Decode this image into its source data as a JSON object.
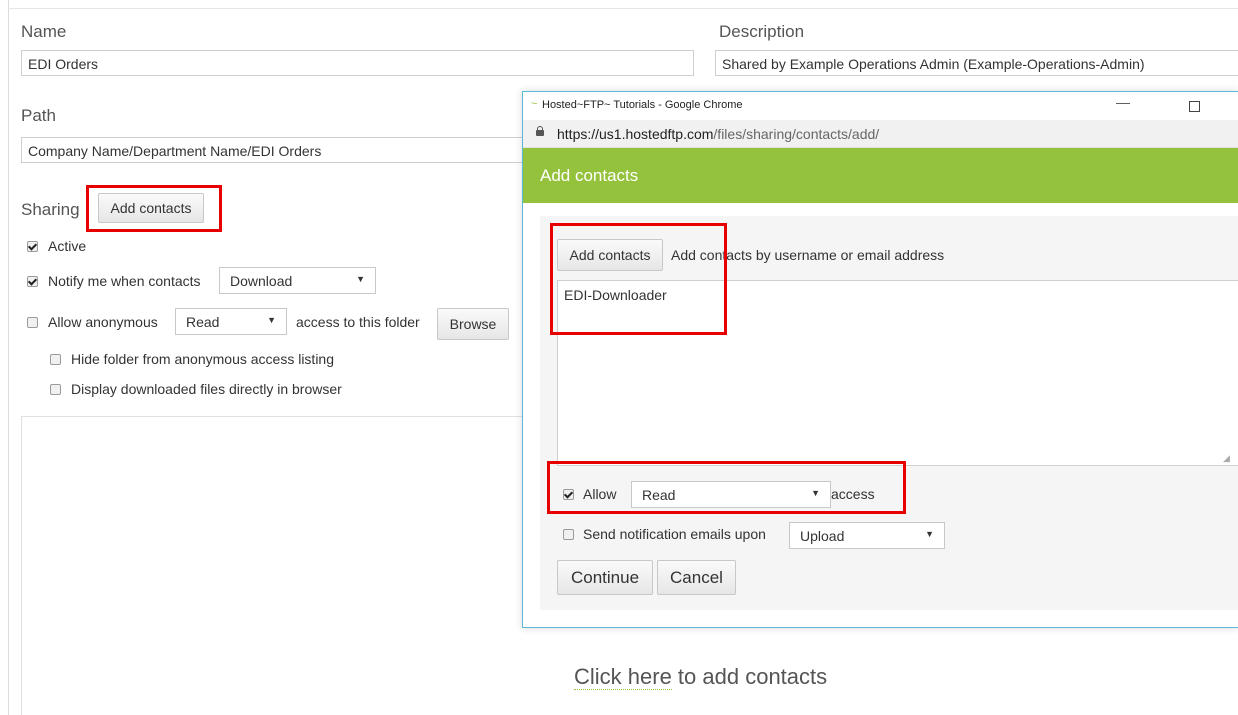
{
  "form": {
    "name_label": "Name",
    "name_value": "EDI Orders",
    "description_label": "Description",
    "description_value": "Shared by Example Operations Admin (Example-Operations-Admin)",
    "path_label": "Path",
    "path_value": "Company Name/Department Name/EDI Orders",
    "sharing_label": "Sharing",
    "add_contacts_button": "Add contacts",
    "active_label": "Active",
    "active_checked": true,
    "notify_label": "Notify me when contacts",
    "notify_checked": true,
    "notify_select": "Download",
    "anon_label": "Allow anonymous",
    "anon_checked": false,
    "anon_select": "Read",
    "anon_suffix": "access to this folder",
    "browse_button": "Browse",
    "hide_folder_label": "Hide folder from anonymous access listing",
    "display_files_label": "Display downloaded files directly in browser",
    "click_here_text": "Click here",
    "click_here_rest": " to add contacts"
  },
  "popup": {
    "window_title": "Hosted~FTP~ Tutorials - Google Chrome",
    "url_host": "https://us1.hostedftp.com",
    "url_path": "/files/sharing/contacts/add/",
    "header_title": "Add contacts",
    "header_color": "#95c23d",
    "add_contacts_button": "Add contacts",
    "add_contacts_hint": "Add contacts by username or email address",
    "contacts_value": "EDI-Downloader",
    "allow_label": "Allow",
    "allow_checked": true,
    "allow_select": "Read",
    "allow_suffix": "access",
    "notify_label": "Send notification emails upon",
    "notify_checked": false,
    "notify_select": "Upload",
    "continue_button": "Continue",
    "cancel_button": "Cancel",
    "minimize_icon": "minimize-icon",
    "maximize_icon": "maximize-icon",
    "lock_icon": "lock-icon"
  }
}
